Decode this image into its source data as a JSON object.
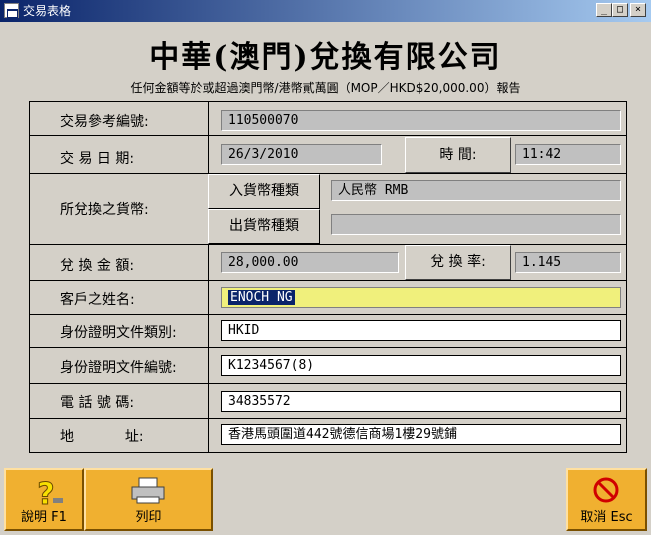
{
  "window": {
    "title": "交易表格",
    "min_label": "_",
    "max_label": "□",
    "close_label": "×"
  },
  "header": {
    "company": "中華(澳門)兌換有限公司",
    "notice": "任何金額等於或超過澳門幣/港幣貳萬圓（MOP／HKD$20,000.00）報告"
  },
  "form": {
    "ref_label": "交易參考編號:",
    "ref_value": "110500070",
    "date_label": "交 易 日 期:",
    "date_value": "26/3/2010",
    "time_label": "時 間:",
    "time_value": "11:42",
    "currency_label": "所兌換之貨幣:",
    "in_currency_label": "入貨幣種類",
    "in_currency_value": "人民幣 RMB",
    "out_currency_label": "出貨幣種類",
    "out_currency_value": "",
    "amount_label": "兌 換 金 額:",
    "amount_value": "28,000.00",
    "rate_label": "兌 換 率:",
    "rate_value": "1.145",
    "name_label": "客戶之姓名:",
    "name_value": "ENOCH NG",
    "id_type_label": "身份證明文件類別:",
    "id_type_value": "HKID",
    "id_no_label": "身份證明文件編號:",
    "id_no_value": "K1234567(8)",
    "phone_label": "電 話 號 碼:",
    "phone_value": "34835572",
    "address_label_a": "地",
    "address_label_b": "址:",
    "address_value": "香港馬頭圍道442號德信商場1樓29號鋪"
  },
  "buttons": {
    "help_label": "說明 F1",
    "print_label": "列印",
    "cancel_label": "取消 Esc"
  },
  "icons": [
    "app-icon",
    "help-question-icon",
    "printer-icon",
    "cancel-icon"
  ]
}
